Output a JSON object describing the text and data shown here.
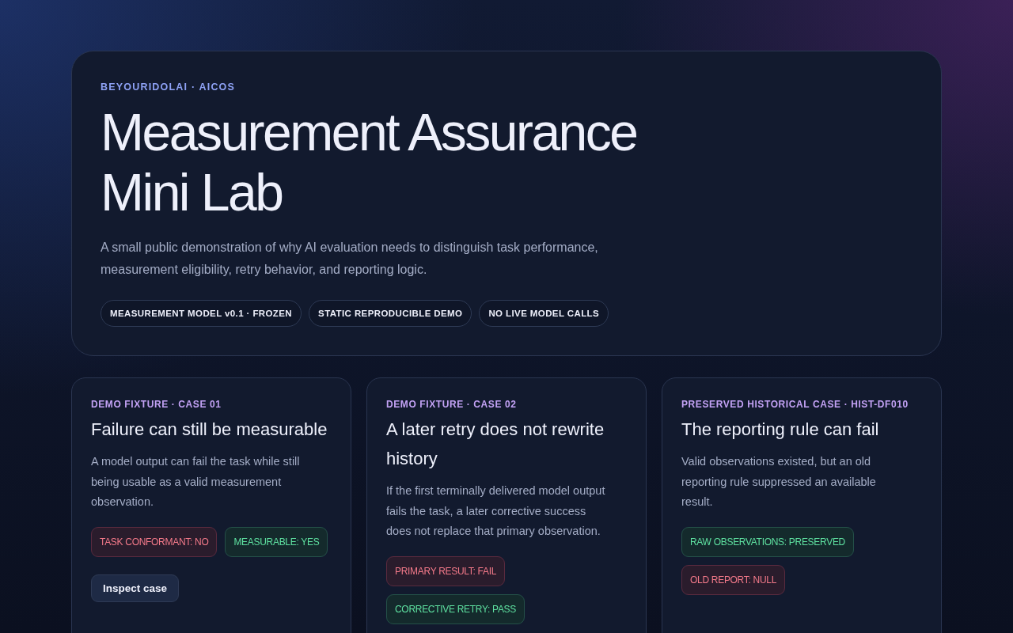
{
  "hero": {
    "eyebrow": "BEYOURIDOLAI · AICOS",
    "title_lines": [
      "Measurement Assurance",
      "Mini Lab"
    ],
    "description": "A small public demonstration of why AI evaluation needs to distinguish task performance, measurement eligibility, retry behavior, and reporting logic.",
    "chips": [
      "MEASUREMENT MODEL v0.1 · FROZEN",
      "STATIC REPRODUCIBLE DEMO",
      "NO LIVE MODEL CALLS"
    ]
  },
  "cases": [
    {
      "eyebrow": "DEMO FIXTURE · CASE 01",
      "title": "Failure can still be measurable",
      "description": "A model output can fail the task while still being usable as a valid measurement observation.",
      "badges": [
        {
          "label": "TASK CONFORMANT: NO",
          "kind": "fail"
        },
        {
          "label": "MEASURABLE: YES",
          "kind": "pass"
        }
      ],
      "button": "Inspect case"
    },
    {
      "eyebrow": "DEMO FIXTURE · CASE 02",
      "title": "A later retry does not rewrite history",
      "description": "If the first terminally delivered model output fails the task, a later corrective success does not replace that primary observation.",
      "badges": [
        {
          "label": "PRIMARY RESULT: FAIL",
          "kind": "fail"
        },
        {
          "label": "CORRECTIVE RETRY: PASS",
          "kind": "pass"
        }
      ]
    },
    {
      "eyebrow": "PRESERVED HISTORICAL CASE · HIST-DF010",
      "title": "The reporting rule can fail",
      "description": "Valid observations existed, but an old reporting rule suppressed an available result.",
      "badges": [
        {
          "label": "RAW OBSERVATIONS: PRESERVED",
          "kind": "pass"
        },
        {
          "label": "OLD REPORT: NULL",
          "kind": "fail"
        }
      ]
    }
  ]
}
